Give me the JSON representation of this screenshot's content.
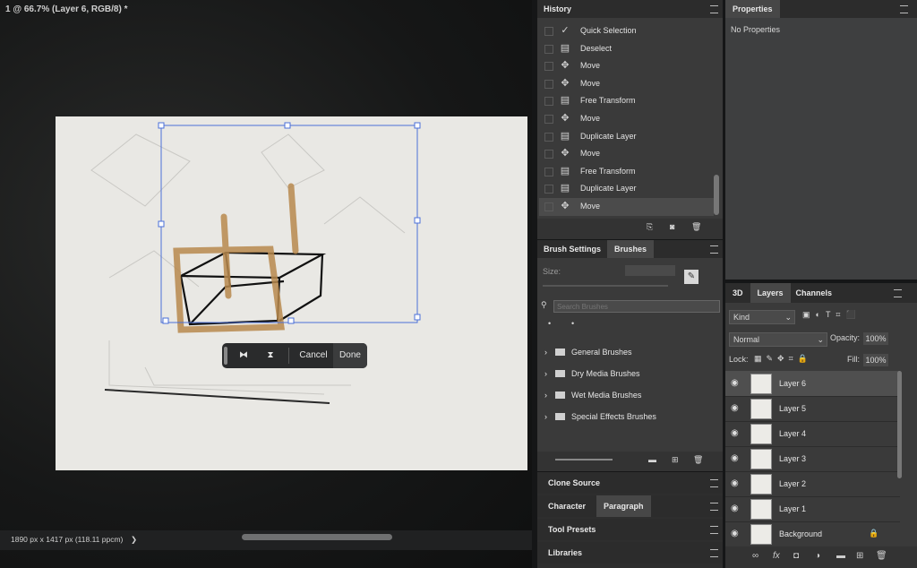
{
  "document": {
    "tab_title": "1 @ 66.7% (Layer 6, RGB/8) *",
    "status": "1890 px x 1417 px (118.11 ppcm)",
    "status_arrow": "❯"
  },
  "transform_toolbar": {
    "flip_h_icon": "flip-horizontal-icon",
    "flip_v_icon": "flip-vertical-icon",
    "cancel_label": "Cancel",
    "done_label": "Done"
  },
  "history": {
    "title": "History",
    "items": [
      {
        "label": "Quick Selection",
        "icon": "quick-selection-icon"
      },
      {
        "label": "Deselect",
        "icon": "document-icon"
      },
      {
        "label": "Move",
        "icon": "move-icon"
      },
      {
        "label": "Move",
        "icon": "move-icon"
      },
      {
        "label": "Free Transform",
        "icon": "document-icon"
      },
      {
        "label": "Move",
        "icon": "move-icon"
      },
      {
        "label": "Duplicate Layer",
        "icon": "document-icon"
      },
      {
        "label": "Move",
        "icon": "move-icon"
      },
      {
        "label": "Free Transform",
        "icon": "document-icon"
      },
      {
        "label": "Duplicate Layer",
        "icon": "document-icon"
      },
      {
        "label": "Move",
        "icon": "move-icon"
      }
    ]
  },
  "properties": {
    "title": "Properties",
    "empty_text": "No Properties"
  },
  "brushes": {
    "tab_settings": "Brush Settings",
    "tab_brushes": "Brushes",
    "size_label": "Size:",
    "search_placeholder": "Search Brushes",
    "folders": [
      "General Brushes",
      "Dry Media Brushes",
      "Wet Media Brushes",
      "Special Effects Brushes"
    ]
  },
  "collapsed_panels": {
    "clone_source": "Clone Source",
    "character": "Character",
    "paragraph": "Paragraph",
    "tool_presets": "Tool Presets",
    "libraries": "Libraries"
  },
  "layers": {
    "tab_3d": "3D",
    "tab_layers": "Layers",
    "tab_channels": "Channels",
    "filter_kind": "Kind",
    "blend_mode": "Normal",
    "opacity_label": "Opacity:",
    "opacity_value": "100%",
    "lock_label": "Lock:",
    "fill_label": "Fill:",
    "fill_value": "100%",
    "items": [
      "Layer 6",
      "Layer 5",
      "Layer 4",
      "Layer 3",
      "Layer 2",
      "Layer 1",
      "Background"
    ],
    "selected_index": 0,
    "footer_fx": "fx"
  },
  "colors": {
    "accent_blue": "#4a6fd8",
    "orange_stroke": "#b8894e",
    "panel_bg": "#3a3a3a"
  }
}
